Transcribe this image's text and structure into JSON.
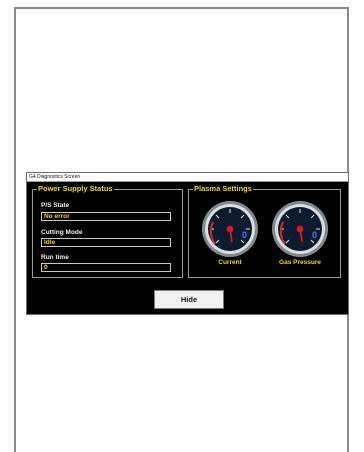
{
  "window": {
    "title": "G4 Diagnostics Screen"
  },
  "power_supply": {
    "title": "Power Supply Status",
    "ps_state_label": "P/S State",
    "ps_state_value": "No error",
    "cutting_mode_label": "Cutting Mode",
    "cutting_mode_value": "Idle",
    "run_time_label": "Run time",
    "run_time_value": "0"
  },
  "plasma": {
    "title": "Plasma Settings",
    "gauges": [
      {
        "label": "Current",
        "readout": "0"
      },
      {
        "label": "Gas Pressure",
        "readout": "0"
      }
    ]
  },
  "buttons": {
    "hide": "Hide"
  },
  "colors": {
    "accent": "#f5d515",
    "background": "#000000"
  }
}
